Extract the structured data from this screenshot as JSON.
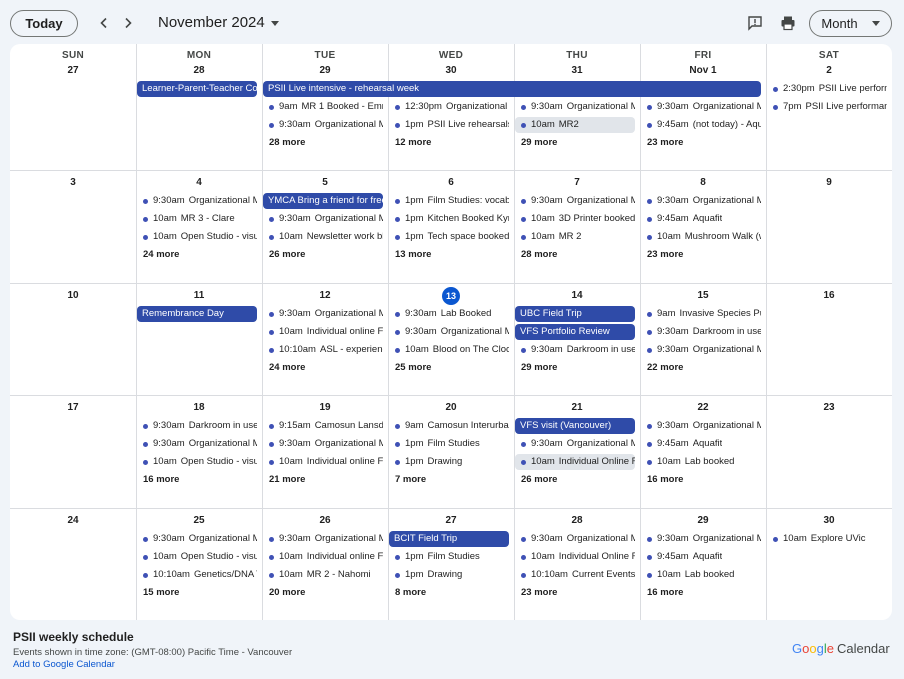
{
  "toolbar": {
    "today_label": "Today",
    "month_title": "November 2024",
    "view_label": "Month"
  },
  "day_headers": [
    "SUN",
    "MON",
    "TUE",
    "WED",
    "THU",
    "FRI",
    "SAT"
  ],
  "weeks": [
    {
      "dates": [
        "27",
        "28",
        "29",
        "30",
        "31",
        "Nov 1",
        "2"
      ],
      "bars": [
        {
          "col": 1,
          "span": 1,
          "row": 0,
          "title": "Learner-Parent-Teacher Co"
        },
        {
          "col": 2,
          "span": 4,
          "row": 0,
          "title": "PSII Live intensive - rehearsal week"
        }
      ],
      "events": [
        {
          "col": 2,
          "row": 1,
          "time": "9am",
          "title": "MR 1 Booked - Emm"
        },
        {
          "col": 2,
          "row": 2,
          "time": "9:30am",
          "title": "Organizational M"
        },
        {
          "col": 3,
          "row": 1,
          "time": "12:30pm",
          "title": "Organizational M"
        },
        {
          "col": 3,
          "row": 2,
          "time": "1pm",
          "title": "PSII Live rehearsals"
        },
        {
          "col": 4,
          "row": 1,
          "time": "9:30am",
          "title": "Organizational M"
        },
        {
          "col": 4,
          "row": 2,
          "time": "10am",
          "title": "MR2",
          "selected": true
        },
        {
          "col": 5,
          "row": 1,
          "time": "9:30am",
          "title": "Organizational M"
        },
        {
          "col": 5,
          "row": 2,
          "time": "9:45am",
          "title": "(not today) - Aqu"
        },
        {
          "col": 6,
          "row": 0,
          "time": "2:30pm",
          "title": "PSII Live perform"
        },
        {
          "col": 6,
          "row": 1,
          "time": "7pm",
          "title": "PSII Live performan"
        }
      ],
      "more": [
        {
          "col": 2,
          "label": "28 more"
        },
        {
          "col": 3,
          "label": "12 more"
        },
        {
          "col": 4,
          "label": "29 more"
        },
        {
          "col": 5,
          "label": "23 more"
        }
      ]
    },
    {
      "dates": [
        "3",
        "4",
        "5",
        "6",
        "7",
        "8",
        "9"
      ],
      "bars": [
        {
          "col": 2,
          "span": 1,
          "row": 0,
          "title": "YMCA Bring a friend for free"
        }
      ],
      "events": [
        {
          "col": 1,
          "row": 0,
          "time": "9:30am",
          "title": "Organizational M"
        },
        {
          "col": 1,
          "row": 1,
          "time": "10am",
          "title": "MR 3 - Clare"
        },
        {
          "col": 1,
          "row": 2,
          "time": "10am",
          "title": "Open Studio - visu"
        },
        {
          "col": 2,
          "row": 1,
          "time": "9:30am",
          "title": "Organizational M"
        },
        {
          "col": 2,
          "row": 2,
          "time": "10am",
          "title": "Newsletter work bl"
        },
        {
          "col": 3,
          "row": 0,
          "time": "1pm",
          "title": "Film Studies: vocabu"
        },
        {
          "col": 3,
          "row": 1,
          "time": "1pm",
          "title": "Kitchen Booked Kyra"
        },
        {
          "col": 3,
          "row": 2,
          "time": "1pm",
          "title": "Tech space booked"
        },
        {
          "col": 4,
          "row": 0,
          "time": "9:30am",
          "title": "Organizational M"
        },
        {
          "col": 4,
          "row": 1,
          "time": "10am",
          "title": "3D Printer booked"
        },
        {
          "col": 4,
          "row": 2,
          "time": "10am",
          "title": "MR 2"
        },
        {
          "col": 5,
          "row": 0,
          "time": "9:30am",
          "title": "Organizational M"
        },
        {
          "col": 5,
          "row": 1,
          "time": "9:45am",
          "title": "Aquafit"
        },
        {
          "col": 5,
          "row": 2,
          "time": "10am",
          "title": "Mushroom Walk (w"
        }
      ],
      "more": [
        {
          "col": 1,
          "label": "24 more"
        },
        {
          "col": 2,
          "label": "26 more"
        },
        {
          "col": 3,
          "label": "13 more"
        },
        {
          "col": 4,
          "label": "28 more"
        },
        {
          "col": 5,
          "label": "23 more"
        }
      ]
    },
    {
      "dates": [
        "10",
        "11",
        "12",
        "13",
        "14",
        "15",
        "16"
      ],
      "today_col": 3,
      "bars": [
        {
          "col": 1,
          "span": 1,
          "row": 0,
          "title": "Remembrance Day"
        },
        {
          "col": 4,
          "span": 1,
          "row": 0,
          "title": "UBC Field Trip"
        },
        {
          "col": 4,
          "span": 1,
          "row": 1,
          "title": "VFS Portfolio Review"
        }
      ],
      "events": [
        {
          "col": 2,
          "row": 0,
          "time": "9:30am",
          "title": "Organizational M"
        },
        {
          "col": 2,
          "row": 1,
          "time": "10am",
          "title": "Individual online Fr"
        },
        {
          "col": 2,
          "row": 2,
          "time": "10:10am",
          "title": "ASL - experienc"
        },
        {
          "col": 3,
          "row": 0,
          "time": "9:30am",
          "title": "Lab Booked"
        },
        {
          "col": 3,
          "row": 1,
          "time": "9:30am",
          "title": "Organizational M"
        },
        {
          "col": 3,
          "row": 2,
          "time": "10am",
          "title": "Blood on The Clock"
        },
        {
          "col": 4,
          "row": 2,
          "time": "9:30am",
          "title": "Darkroom in use"
        },
        {
          "col": 5,
          "row": 0,
          "time": "9am",
          "title": "Invasive Species Pu"
        },
        {
          "col": 5,
          "row": 1,
          "time": "9:30am",
          "title": "Darkroom in use"
        },
        {
          "col": 5,
          "row": 2,
          "time": "9:30am",
          "title": "Organizational M"
        }
      ],
      "more": [
        {
          "col": 2,
          "label": "24 more"
        },
        {
          "col": 3,
          "label": "25 more"
        },
        {
          "col": 4,
          "label": "29 more"
        },
        {
          "col": 5,
          "label": "22 more"
        }
      ]
    },
    {
      "dates": [
        "17",
        "18",
        "19",
        "20",
        "21",
        "22",
        "23"
      ],
      "bars": [
        {
          "col": 4,
          "span": 1,
          "row": 0,
          "title": "VFS visit (Vancouver)"
        }
      ],
      "events": [
        {
          "col": 1,
          "row": 0,
          "time": "9:30am",
          "title": "Darkroom in use"
        },
        {
          "col": 1,
          "row": 1,
          "time": "9:30am",
          "title": "Organizational M"
        },
        {
          "col": 1,
          "row": 2,
          "time": "10am",
          "title": "Open Studio - visu"
        },
        {
          "col": 2,
          "row": 0,
          "time": "9:15am",
          "title": "Camosun Lansdo"
        },
        {
          "col": 2,
          "row": 1,
          "time": "9:30am",
          "title": "Organizational M"
        },
        {
          "col": 2,
          "row": 2,
          "time": "10am",
          "title": "Individual online Fr"
        },
        {
          "col": 3,
          "row": 0,
          "time": "9am",
          "title": "Camosun Interurba"
        },
        {
          "col": 3,
          "row": 1,
          "time": "1pm",
          "title": "Film Studies"
        },
        {
          "col": 3,
          "row": 2,
          "time": "1pm",
          "title": "Drawing"
        },
        {
          "col": 4,
          "row": 1,
          "time": "9:30am",
          "title": "Organizational M"
        },
        {
          "col": 4,
          "row": 2,
          "time": "10am",
          "title": "Individual Online F",
          "selected": true
        },
        {
          "col": 5,
          "row": 0,
          "time": "9:30am",
          "title": "Organizational M"
        },
        {
          "col": 5,
          "row": 1,
          "time": "9:45am",
          "title": "Aquafit"
        },
        {
          "col": 5,
          "row": 2,
          "time": "10am",
          "title": "Lab booked"
        }
      ],
      "more": [
        {
          "col": 1,
          "label": "16 more"
        },
        {
          "col": 2,
          "label": "21 more"
        },
        {
          "col": 3,
          "label": "7 more"
        },
        {
          "col": 4,
          "label": "26 more"
        },
        {
          "col": 5,
          "label": "16 more"
        }
      ]
    },
    {
      "dates": [
        "24",
        "25",
        "26",
        "27",
        "28",
        "29",
        "30"
      ],
      "bars": [
        {
          "col": 3,
          "span": 1,
          "row": 0,
          "title": "BCIT Field Trip"
        }
      ],
      "events": [
        {
          "col": 1,
          "row": 0,
          "time": "9:30am",
          "title": "Organizational M"
        },
        {
          "col": 1,
          "row": 1,
          "time": "10am",
          "title": "Open Studio - visu"
        },
        {
          "col": 1,
          "row": 2,
          "time": "10:10am",
          "title": "Genetics/DNA T"
        },
        {
          "col": 2,
          "row": 0,
          "time": "9:30am",
          "title": "Organizational M"
        },
        {
          "col": 2,
          "row": 1,
          "time": "10am",
          "title": "Individual online Fr"
        },
        {
          "col": 2,
          "row": 2,
          "time": "10am",
          "title": "MR 2 - Nahomi"
        },
        {
          "col": 3,
          "row": 1,
          "time": "1pm",
          "title": "Film Studies"
        },
        {
          "col": 3,
          "row": 2,
          "time": "1pm",
          "title": "Drawing"
        },
        {
          "col": 4,
          "row": 0,
          "time": "9:30am",
          "title": "Organizational M"
        },
        {
          "col": 4,
          "row": 1,
          "time": "10am",
          "title": "Individual Online F"
        },
        {
          "col": 4,
          "row": 2,
          "time": "10:10am",
          "title": "Current Events a"
        },
        {
          "col": 5,
          "row": 0,
          "time": "9:30am",
          "title": "Organizational M"
        },
        {
          "col": 5,
          "row": 1,
          "time": "9:45am",
          "title": "Aquafit"
        },
        {
          "col": 5,
          "row": 2,
          "time": "10am",
          "title": "Lab booked"
        },
        {
          "col": 6,
          "row": 0,
          "time": "10am",
          "title": "Explore UVic"
        }
      ],
      "more": [
        {
          "col": 1,
          "label": "15 more"
        },
        {
          "col": 2,
          "label": "20 more"
        },
        {
          "col": 3,
          "label": "8 more"
        },
        {
          "col": 4,
          "label": "23 more"
        },
        {
          "col": 5,
          "label": "16 more"
        }
      ]
    }
  ],
  "footer": {
    "title": "PSII weekly schedule",
    "timezone": "Events shown in time zone: (GMT-08:00) Pacific Time - Vancouver",
    "add_link": "Add to Google Calendar",
    "logo_google": "Google",
    "logo_calendar": "Calendar"
  },
  "colors": {
    "event_bar": "#2f4ba8",
    "event_dot": "#3f51b5",
    "today_circle": "#0b57d0",
    "link": "#0b57d0"
  },
  "icons": {
    "prev": "chevron-left-icon",
    "next": "chevron-right-icon",
    "feedback": "feedback-icon",
    "print": "print-icon"
  }
}
